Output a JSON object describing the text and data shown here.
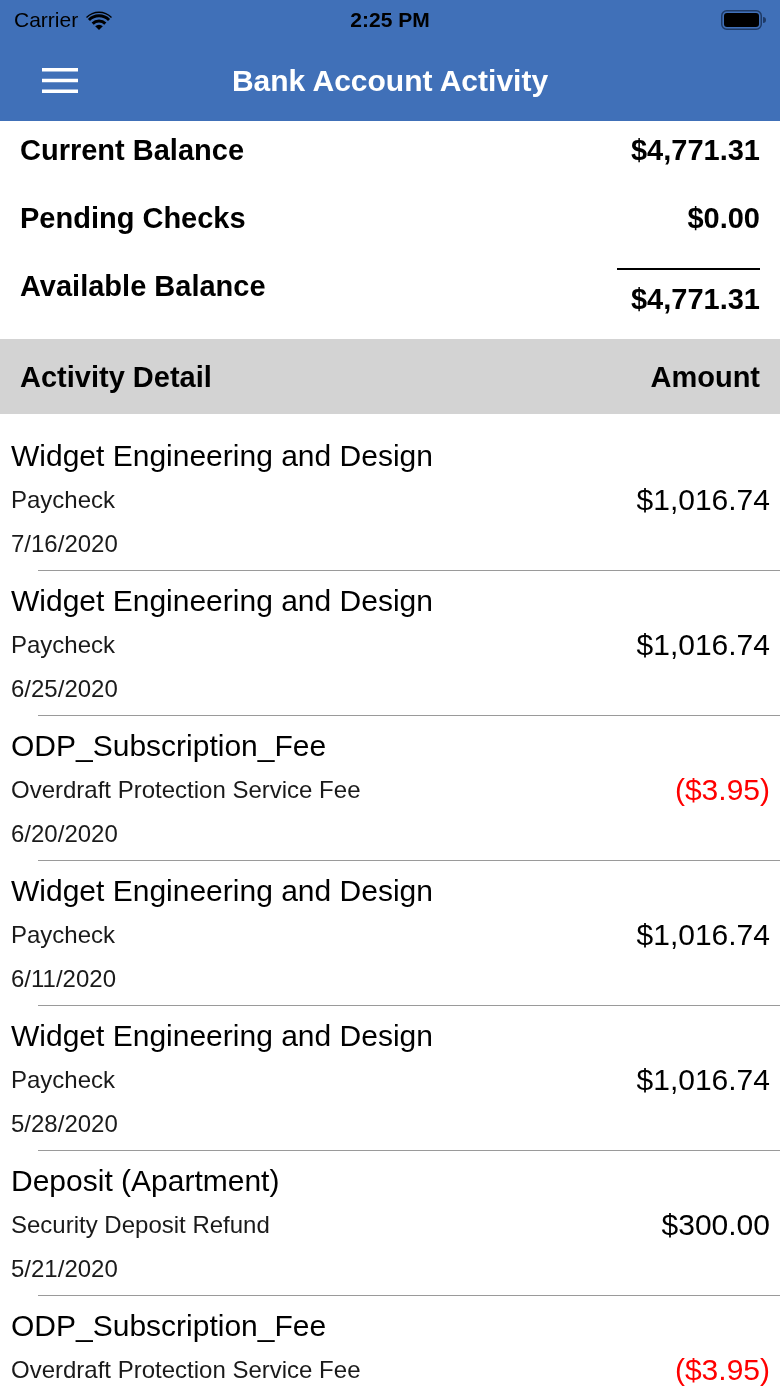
{
  "status_bar": {
    "carrier": "Carrier",
    "time": "2:25 PM"
  },
  "nav_bar": {
    "title": "Bank Account Activity"
  },
  "balances": [
    {
      "kind": "line",
      "label": "Current Balance",
      "value": "$4,771.31"
    },
    {
      "kind": "line",
      "label": "Pending Checks",
      "value": "$0.00"
    },
    {
      "kind": "total",
      "label": "Available Balance",
      "value": "$4,771.31"
    }
  ],
  "activity_header": {
    "title": "Activity Detail",
    "amount": "Amount"
  },
  "transactions": [
    {
      "kind": "credit",
      "payee": "Widget Engineering and Design",
      "memo": "Paycheck",
      "date": "7/16/2020",
      "amount": "$1,016.74"
    },
    {
      "kind": "credit",
      "payee": "Widget Engineering and Design",
      "memo": "Paycheck",
      "date": "6/25/2020",
      "amount": "$1,016.74"
    },
    {
      "kind": "debit",
      "payee": "ODP_Subscription_Fee",
      "memo": "Overdraft Protection Service Fee",
      "date": "6/20/2020",
      "amount": "($3.95)"
    },
    {
      "kind": "credit",
      "payee": "Widget Engineering and Design",
      "memo": "Paycheck",
      "date": "6/11/2020",
      "amount": "$1,016.74"
    },
    {
      "kind": "credit",
      "payee": "Widget Engineering and Design",
      "memo": "Paycheck",
      "date": "5/28/2020",
      "amount": "$1,016.74"
    },
    {
      "kind": "credit",
      "payee": "Deposit (Apartment)",
      "memo": "Security Deposit Refund",
      "date": "5/21/2020",
      "amount": "$300.00"
    },
    {
      "kind": "debit",
      "payee": "ODP_Subscription_Fee",
      "memo": "Overdraft Protection Service Fee",
      "amount": "($3.95)"
    }
  ]
}
